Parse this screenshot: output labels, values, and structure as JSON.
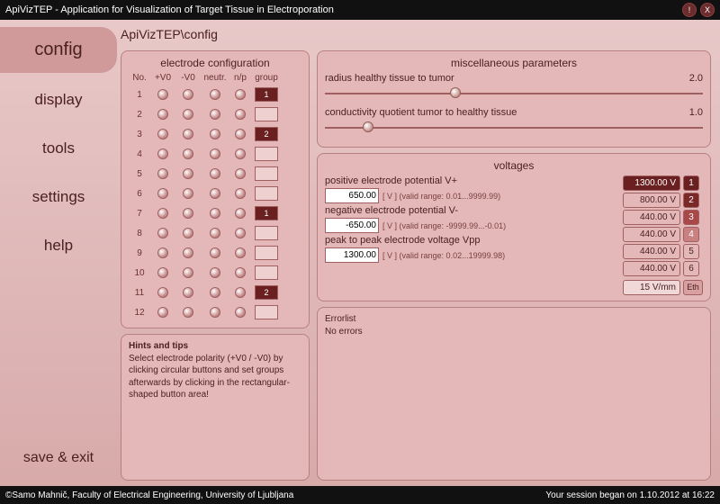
{
  "title": "ApiVizTEP - Application for Visualization of Target Tissue in Electroporation",
  "winbtns": {
    "min": "!",
    "close": "X"
  },
  "breadcrumb": "ApiVizTEP\\config",
  "sidebar": [
    "config",
    "display",
    "tools",
    "settings",
    "help",
    "save & exit"
  ],
  "electrode": {
    "title": "electrode configuration",
    "headers": [
      "No.",
      "+V0",
      "-V0",
      "neutr.",
      "n/p",
      "group"
    ],
    "rows": [
      {
        "no": 1,
        "group": "1",
        "filled": true
      },
      {
        "no": 2,
        "group": "",
        "filled": false
      },
      {
        "no": 3,
        "group": "2",
        "filled": true
      },
      {
        "no": 4,
        "group": "",
        "filled": false
      },
      {
        "no": 5,
        "group": "",
        "filled": false
      },
      {
        "no": 6,
        "group": "",
        "filled": false
      },
      {
        "no": 7,
        "group": "1",
        "filled": true
      },
      {
        "no": 8,
        "group": "",
        "filled": false
      },
      {
        "no": 9,
        "group": "",
        "filled": false
      },
      {
        "no": 10,
        "group": "",
        "filled": false
      },
      {
        "no": 11,
        "group": "2",
        "filled": true
      },
      {
        "no": 12,
        "group": "",
        "filled": false
      }
    ]
  },
  "hints": {
    "title": "Hints and tips",
    "body": "Select electrode polarity (+V0 / -V0) by clicking circular buttons and set groups afterwards by clicking in the rectangular-shaped button area!"
  },
  "misc": {
    "title": "miscellaneous parameters",
    "p1": {
      "label": "radius healthy tissue to tumor",
      "val": "2.0",
      "pos": 33
    },
    "p2": {
      "label": "conductivity quotient tumor to healthy tissue",
      "val": "1.0",
      "pos": 10
    }
  },
  "volt": {
    "title": "voltages",
    "pos": {
      "label": "positive electrode potential V+",
      "val": "650.00",
      "unit": "[ V ]",
      "range": "(valid range: 0.01...9999.99)"
    },
    "neg": {
      "label": "negative electrode potential V-",
      "val": "-650.00",
      "unit": "[ V ]",
      "range": "(valid range: -9999.99...-0.01)"
    },
    "vpp": {
      "label": "peak to peak electrode voltage Vpp",
      "val": "1300.00",
      "unit": "[ V ]",
      "range": "(valid range: 0.02...19999.98)"
    },
    "list": [
      {
        "v": "1300.00 V",
        "n": "1",
        "cls": "d1",
        "sel": true
      },
      {
        "v": "800.00 V",
        "n": "2",
        "cls": "d2",
        "sel": false
      },
      {
        "v": "440.00 V",
        "n": "3",
        "cls": "d3",
        "sel": false
      },
      {
        "v": "440.00 V",
        "n": "4",
        "cls": "d4",
        "sel": false
      },
      {
        "v": "440.00 V",
        "n": "5",
        "cls": "",
        "sel": false
      },
      {
        "v": "440.00 V",
        "n": "6",
        "cls": "",
        "sel": false
      }
    ],
    "eth": {
      "v": "15 V/mm",
      "b": "Eth"
    }
  },
  "errors": {
    "title": "Errorlist",
    "body": "No errors"
  },
  "footer": {
    "left": "©Samo Mahnič, Faculty of Electrical Engineering, University of Ljubljana",
    "right": "Your session began on 1.10.2012 at 16:22"
  }
}
